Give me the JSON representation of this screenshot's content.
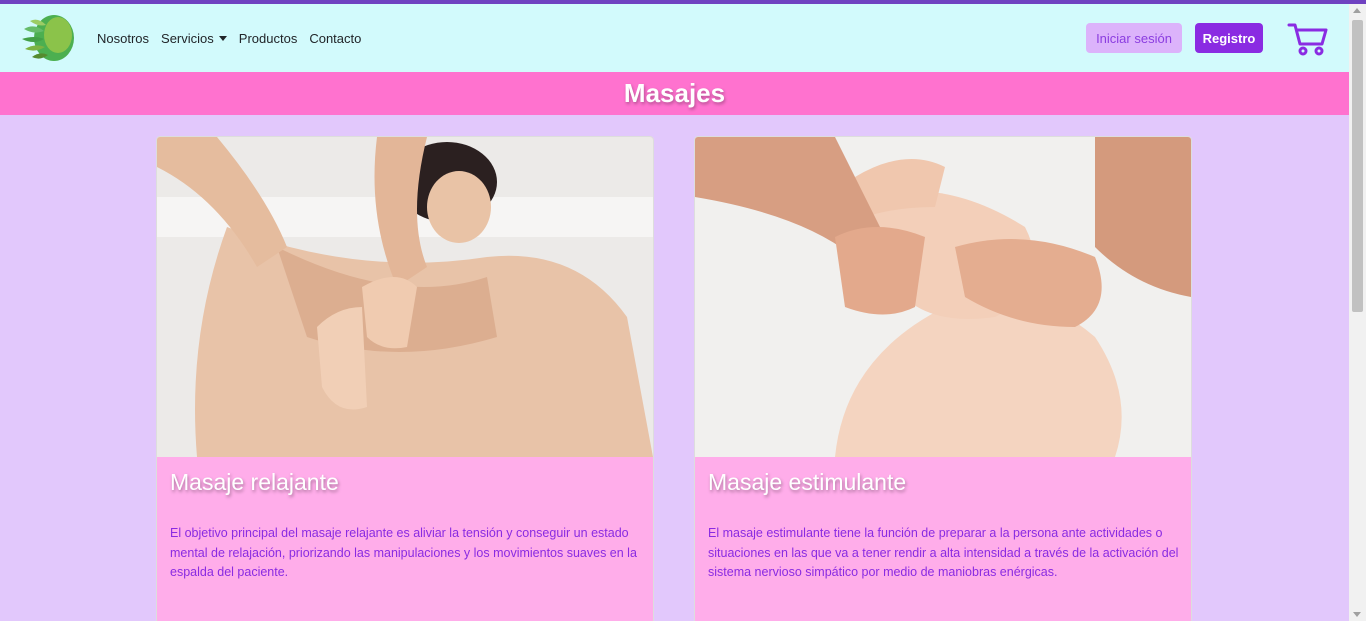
{
  "nav": {
    "links": [
      {
        "label": "Nosotros"
      },
      {
        "label": "Servicios"
      },
      {
        "label": "Productos"
      },
      {
        "label": "Contacto"
      }
    ],
    "login_label": "Iniciar sesión",
    "register_label": "Registro"
  },
  "banner": {
    "title": "Masajes"
  },
  "cards": [
    {
      "title": "Masaje relajante",
      "text": "El objetivo principal del masaje relajante es aliviar la tensión y conseguir un estado mental de relajación, priorizando las manipulaciones y los movimientos suaves en la espalda del paciente."
    },
    {
      "title": "Masaje estimulante",
      "text": "El masaje estimulante tiene la función de preparar a la persona ante actividades o situaciones en las que va a tener rendir a alta intensidad a través de la activación del sistema nervioso simpático por medio de maniobras enérgicas."
    }
  ],
  "colors": {
    "accent": "#8a2be2",
    "navbar_bg": "#d2fafc",
    "banner_bg": "#ff72cf",
    "page_bg": "#e2c8fc",
    "card_bg": "#ffadea"
  },
  "icons": [
    "leaf-logo-icon",
    "chevron-down-icon",
    "cart-icon"
  ]
}
